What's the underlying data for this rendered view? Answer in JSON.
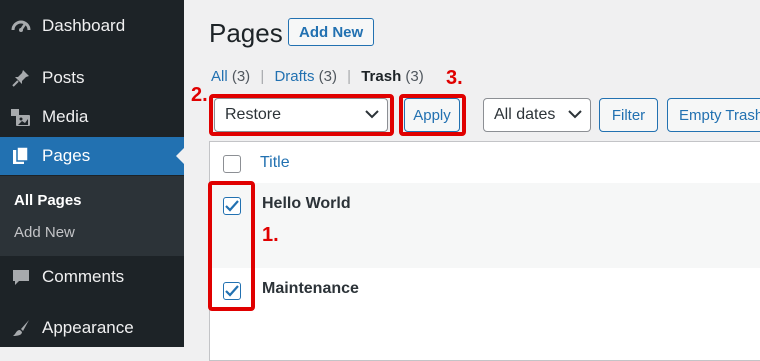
{
  "sidebar": {
    "items": [
      {
        "label": "Dashboard",
        "icon": "dashboard-icon"
      },
      {
        "label": "Posts",
        "icon": "pin-icon"
      },
      {
        "label": "Media",
        "icon": "media-icon"
      },
      {
        "label": "Pages",
        "icon": "pages-icon"
      },
      {
        "label": "Comments",
        "icon": "comments-icon"
      },
      {
        "label": "Appearance",
        "icon": "brush-icon"
      }
    ],
    "submenu": [
      {
        "label": "All Pages"
      },
      {
        "label": "Add New"
      }
    ]
  },
  "header": {
    "title": "Pages",
    "add_new": "Add New"
  },
  "views": {
    "all_label": "All",
    "all_count": "(3)",
    "drafts_label": "Drafts",
    "drafts_count": "(3)",
    "trash_label": "Trash",
    "trash_count": "(3)",
    "separator": "|"
  },
  "bulk": {
    "action": "Restore",
    "apply": "Apply",
    "dates": "All dates",
    "filter": "Filter",
    "empty_trash": "Empty Trash"
  },
  "table": {
    "column_title": "Title",
    "rows": [
      {
        "title": "Hello World",
        "checked": true
      },
      {
        "title": "Maintenance",
        "checked": true
      }
    ]
  },
  "annotations": {
    "step1": "1.",
    "step2": "2.",
    "step3": "3."
  },
  "colors": {
    "annotation": "#e00000",
    "accent": "#2271b1",
    "sidebar": "#1d2327"
  }
}
